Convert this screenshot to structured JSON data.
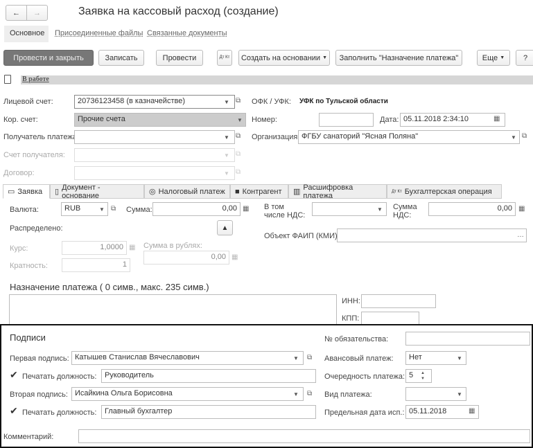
{
  "window": {
    "title": "Заявка на кассовый расход (создание)"
  },
  "nav_tabs": [
    "Основное",
    "Присоединенные файлы",
    "Связанные документы"
  ],
  "toolbar": {
    "post_close": "Провести и закрыть",
    "save": "Записать",
    "post": "Провести",
    "dtkt": "Дт Кт",
    "create_based": "Создать на основании",
    "fill_purpose": "Заполнить \"Назначение платежа\"",
    "more": "Еще",
    "help": "?"
  },
  "status": "В работе",
  "header": {
    "account_label": "Лицевой счет:",
    "account": "20736123458 (в казначействе)",
    "ofk_label": "ОФК / УФК:",
    "ofk": "УФК по Тульской области",
    "corr_label": "Кор. счет:",
    "corr": "Прочие счета",
    "number_label": "Номер:",
    "number": "",
    "date_label": "Дата:",
    "date": "05.11.2018  2:34:10",
    "recipient_label": "Получатель платежа:",
    "recipient": "",
    "org_label": "Организация:",
    "org": "ФГБУ санаторий \"Ясная Поляна\"",
    "recipient_account_label": "Счет получателя:",
    "contract_label": "Договор:"
  },
  "tabs": [
    "Заявка",
    "Документ - основание",
    "Налоговый платеж",
    "Контрагент",
    "Расшифровка платежа",
    "Бухгалтерская операция"
  ],
  "request": {
    "currency_label": "Валюта:",
    "currency": "RUB",
    "sum_label": "Сумма:",
    "sum": "0,00",
    "vat_incl_label": "В том числе НДС:",
    "vat_incl": "",
    "vat_sum_label": "Сумма НДС:",
    "vat_sum": "0,00",
    "distributed_label": "Распределено:",
    "faip_label": "Объект ФАИП (КМИ):",
    "faip": "",
    "rate_label": "Курс:",
    "rate": "1,0000",
    "rub_sum_label": "Сумма в рублях:",
    "rub_sum": "0,00",
    "multiplicity_label": "Кратность:",
    "multiplicity": "1",
    "purpose_title": "Назначение платежа ( 0 симв., макс. 235 симв.)",
    "purpose": "",
    "inn_label": "ИНН:",
    "inn": "",
    "kpp_label": "КПП:",
    "kpp": ""
  },
  "signatures": {
    "title": "Подписи",
    "first_label": "Первая подпись:",
    "first": "Катышев Станислав Вячеславович",
    "print_pos_label": "Печатать должность:",
    "first_pos": "Руководитель",
    "second_label": "Вторая подпись:",
    "second": "Исайкина Ольга Борисовна",
    "second_pos": "Главный бухгалтер",
    "obligation_label": "№ обязательства:",
    "obligation": "",
    "advance_label": "Авансовый платеж:",
    "advance": "Нет",
    "priority_label": "Очередность платежа:",
    "priority": "5",
    "payment_type_label": "Вид платежа:",
    "payment_type": "",
    "deadline_label": "Предельная дата исп.:",
    "deadline": "05.11.2018"
  },
  "comment_label": "Комментарий:",
  "comment": ""
}
